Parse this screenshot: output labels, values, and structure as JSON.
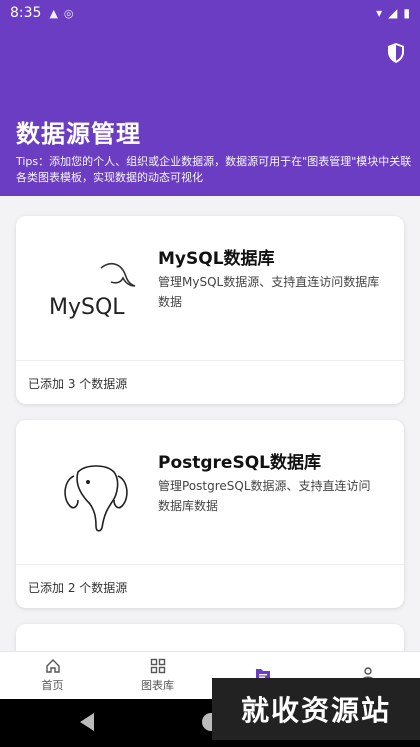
{
  "status_bar": {
    "time": "8:35",
    "icons": [
      "notification-a-icon",
      "cast-icon",
      "wifi-icon",
      "signal-icon",
      "battery-icon"
    ]
  },
  "header": {
    "title": "数据源管理",
    "tips": "Tips：添加您的个人、组织或企业数据源，数据源可用于在\"图表管理\"模块中关联各类图表模板，实现数据的动态可视化",
    "bg_color": "#6a3dc2"
  },
  "cards": [
    {
      "logo_text": "MySQL",
      "name": "MySQL数据库",
      "desc": "管理MySQL数据源、支持直连访问数据库数据",
      "footer": "已添加 3 个数据源"
    },
    {
      "logo_text": "",
      "name": "PostgreSQL数据库",
      "desc": "管理PostgreSQL数据源、支持直连访问数据库数据",
      "footer": "已添加 2 个数据源"
    }
  ],
  "nav": [
    {
      "label": "首页",
      "icon": "home-icon",
      "active": false
    },
    {
      "label": "图表库",
      "icon": "grid-icon",
      "active": false
    },
    {
      "label": "",
      "icon": "folder-icon",
      "active": true
    },
    {
      "label": "",
      "icon": "user-icon",
      "active": false
    }
  ],
  "watermark": "就收资源站"
}
